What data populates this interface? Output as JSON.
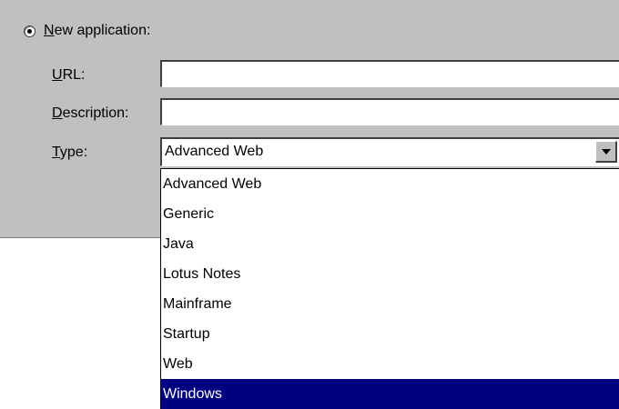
{
  "form": {
    "new_app_label": "New application:",
    "new_app_selected": true,
    "url_label": "URL:",
    "url_value": "",
    "description_label": "Description:",
    "description_value": "",
    "type_label": "Type:",
    "type_value": "Advanced Web"
  },
  "dropdown": {
    "options": [
      "Advanced Web",
      "Generic",
      "Java",
      "Lotus Notes",
      "Mainframe",
      "Startup",
      "Web",
      "Windows"
    ],
    "highlighted_index": 7
  },
  "colors": {
    "panel_bg": "#c0c0c0",
    "highlight_bg": "#000080",
    "highlight_text": "#ffffff"
  },
  "icons": {
    "radio": "radio-selected-icon",
    "dropdown": "dropdown-arrow-icon"
  }
}
